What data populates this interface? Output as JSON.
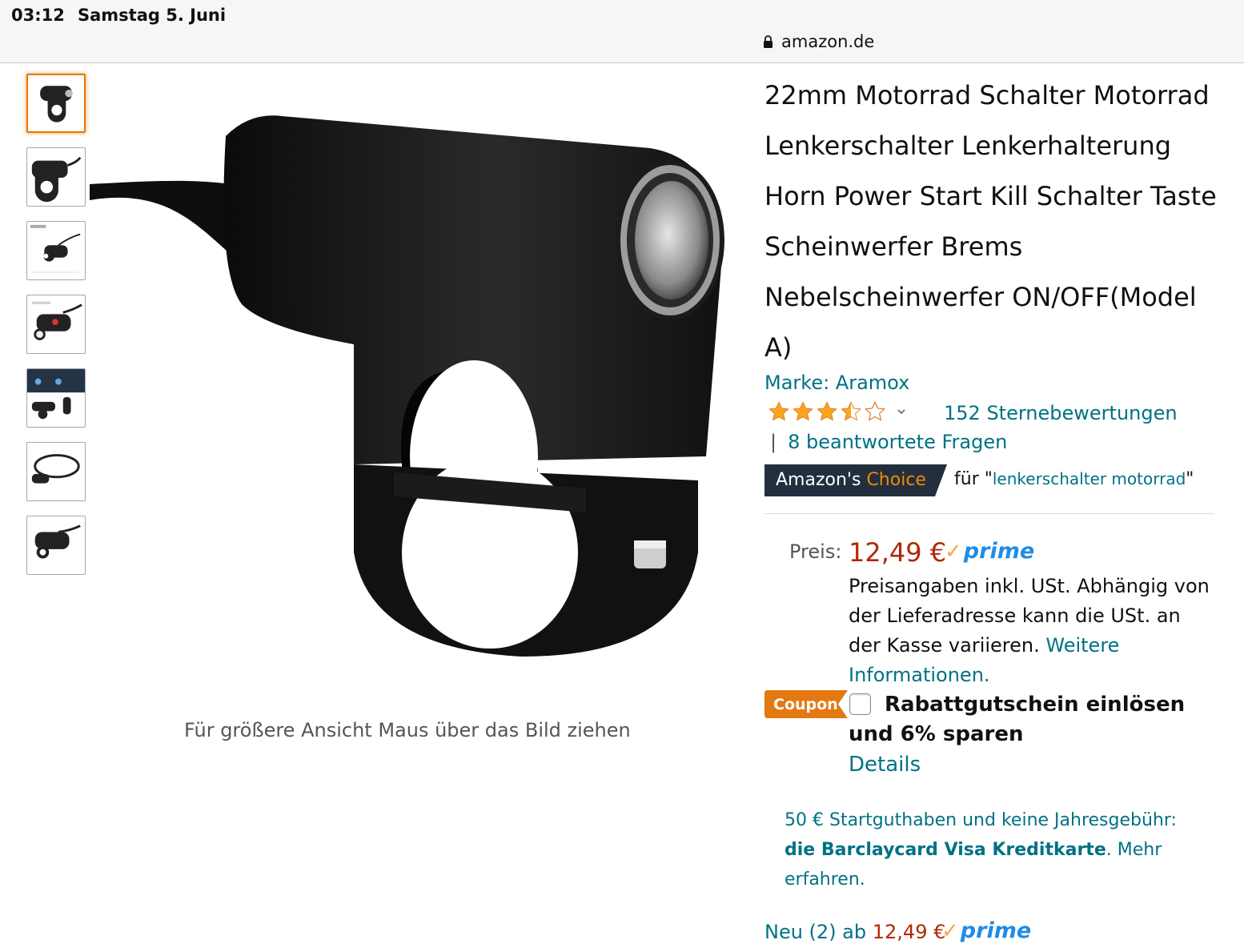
{
  "status_bar": {
    "time": "03:12",
    "date": "Samstag 5. Juni"
  },
  "browser": {
    "url": "amazon.de"
  },
  "gallery": {
    "thumbnails": [
      "thumb-1",
      "thumb-2",
      "thumb-3",
      "thumb-4",
      "thumb-5",
      "thumb-6",
      "thumb-7"
    ],
    "selected_index": 0,
    "hover_hint": "Für größere Ansicht Maus über das Bild ziehen"
  },
  "product": {
    "title": "22mm Motorrad Schalter Motorrad Lenkerschalter Lenkerhalterung Horn Power Start Kill Schalter Taste Scheinwerfer Brems Nebelscheinwerfer ON/OFF(Model A)",
    "brand": "Marke: Aramox",
    "rating": 3.5,
    "ratings_count": "152 Sternebewertungen",
    "qa_separator": "|",
    "answered_questions": "8 beantwortete Fragen",
    "choice_badge": {
      "prefix": "Amazon's",
      "suffix": "Choice"
    },
    "choice_for_prefix": "für \"",
    "choice_keyword": "lenkerschalter motorrad",
    "choice_for_suffix": "\""
  },
  "pricing": {
    "label": "Preis:",
    "price": "12,49 €",
    "prime": "prime",
    "tax_note": "Preisangaben inkl. USt. Abhängig von der Lieferadresse kann die USt. an der Kasse variieren.",
    "tax_link": "Weitere Informationen."
  },
  "coupon": {
    "badge": "Coupon",
    "label": "Rabattgutschein einlösen und 6% sparen",
    "details_link": "Details"
  },
  "promo": {
    "line1": "50 € Startguthaben und keine Jahresgebühr:",
    "bold": "die Barclaycard Visa Kreditkarte",
    "link": ". Mehr erfahren."
  },
  "offers": {
    "prefix": "Neu (2) ab",
    "price": "12,49 €",
    "prime": "prime"
  },
  "colors": {
    "link": "#007185",
    "price": "#b12704",
    "prime_blue": "#1f8ce6",
    "prime_check": "#f3a847",
    "coupon": "#e47911",
    "choice_bg": "#232f3e",
    "choice_accent": "#f08804",
    "selected_thumb": "#e77600"
  }
}
